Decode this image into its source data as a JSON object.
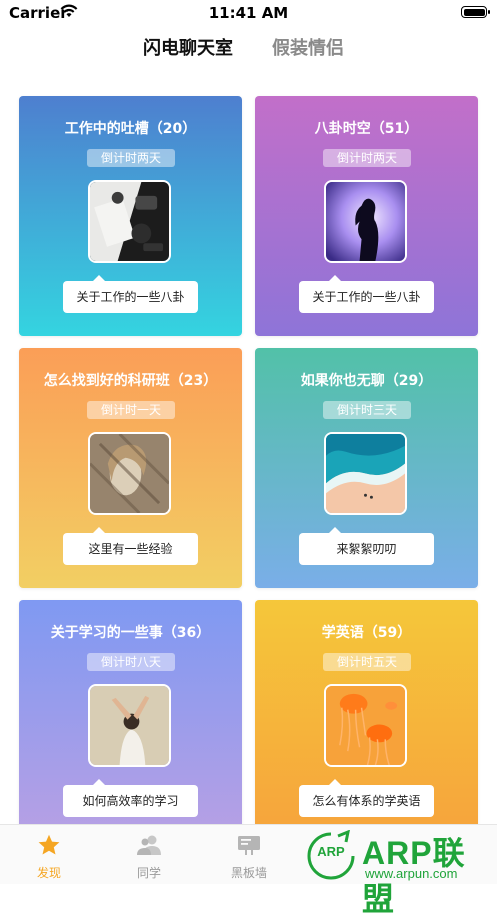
{
  "status_bar": {
    "carrier": "Carrier",
    "time": "11:41 AM"
  },
  "top_tabs": [
    {
      "label": "闪电聊天室",
      "active": true
    },
    {
      "label": "假装情侣",
      "active": false
    }
  ],
  "cards": [
    {
      "title": "工作中的吐槽（20）",
      "countdown": "倒计时两天",
      "bubble": "关于工作的一些八卦",
      "gradient": [
        "#4e7fcf",
        "#34d4e0"
      ],
      "photo": "desk-photo"
    },
    {
      "title": "八卦时空（51）",
      "countdown": "倒计时两天",
      "bubble": "关于工作的一些八卦",
      "gradient": [
        "#c26fc9",
        "#8e74d8"
      ],
      "photo": "silhouette-photo"
    },
    {
      "title": "怎么找到好的科研班（23）",
      "countdown": "倒计时一天",
      "bubble": "这里有一些经验",
      "gradient": [
        "#fb9e57",
        "#f2cf63"
      ],
      "photo": "portrait-photo"
    },
    {
      "title": "如果你也无聊（29）",
      "countdown": "倒计时三天",
      "bubble": "来絮絮叨叨",
      "gradient": [
        "#52c1a8",
        "#7aaee8"
      ],
      "photo": "beach-photo"
    },
    {
      "title": "关于学习的一些事（36）",
      "countdown": "倒计时八天",
      "bubble": "如何高效率的学习",
      "gradient": [
        "#7f99f2",
        "#b8a0e4"
      ],
      "photo": "dancer-photo"
    },
    {
      "title": "学英语（59）",
      "countdown": "倒计时五天",
      "bubble": "怎么有体系的学英语",
      "gradient": [
        "#f5c73a",
        "#f6a33c"
      ],
      "photo": "jellyfish-photo"
    }
  ],
  "tab_bar": [
    {
      "label": "发现",
      "icon": "star-icon",
      "active": true,
      "color": "#f5a623"
    },
    {
      "label": "同学",
      "icon": "people-icon",
      "active": false,
      "color": "#b5b5b5"
    },
    {
      "label": "黑板墙",
      "icon": "blackboard-icon",
      "active": false,
      "color": "#b5b5b5"
    }
  ],
  "watermark": {
    "logo": "ARP",
    "brand": "ARP联盟",
    "url": "www.arpun.com",
    "color": "#20a43a"
  }
}
